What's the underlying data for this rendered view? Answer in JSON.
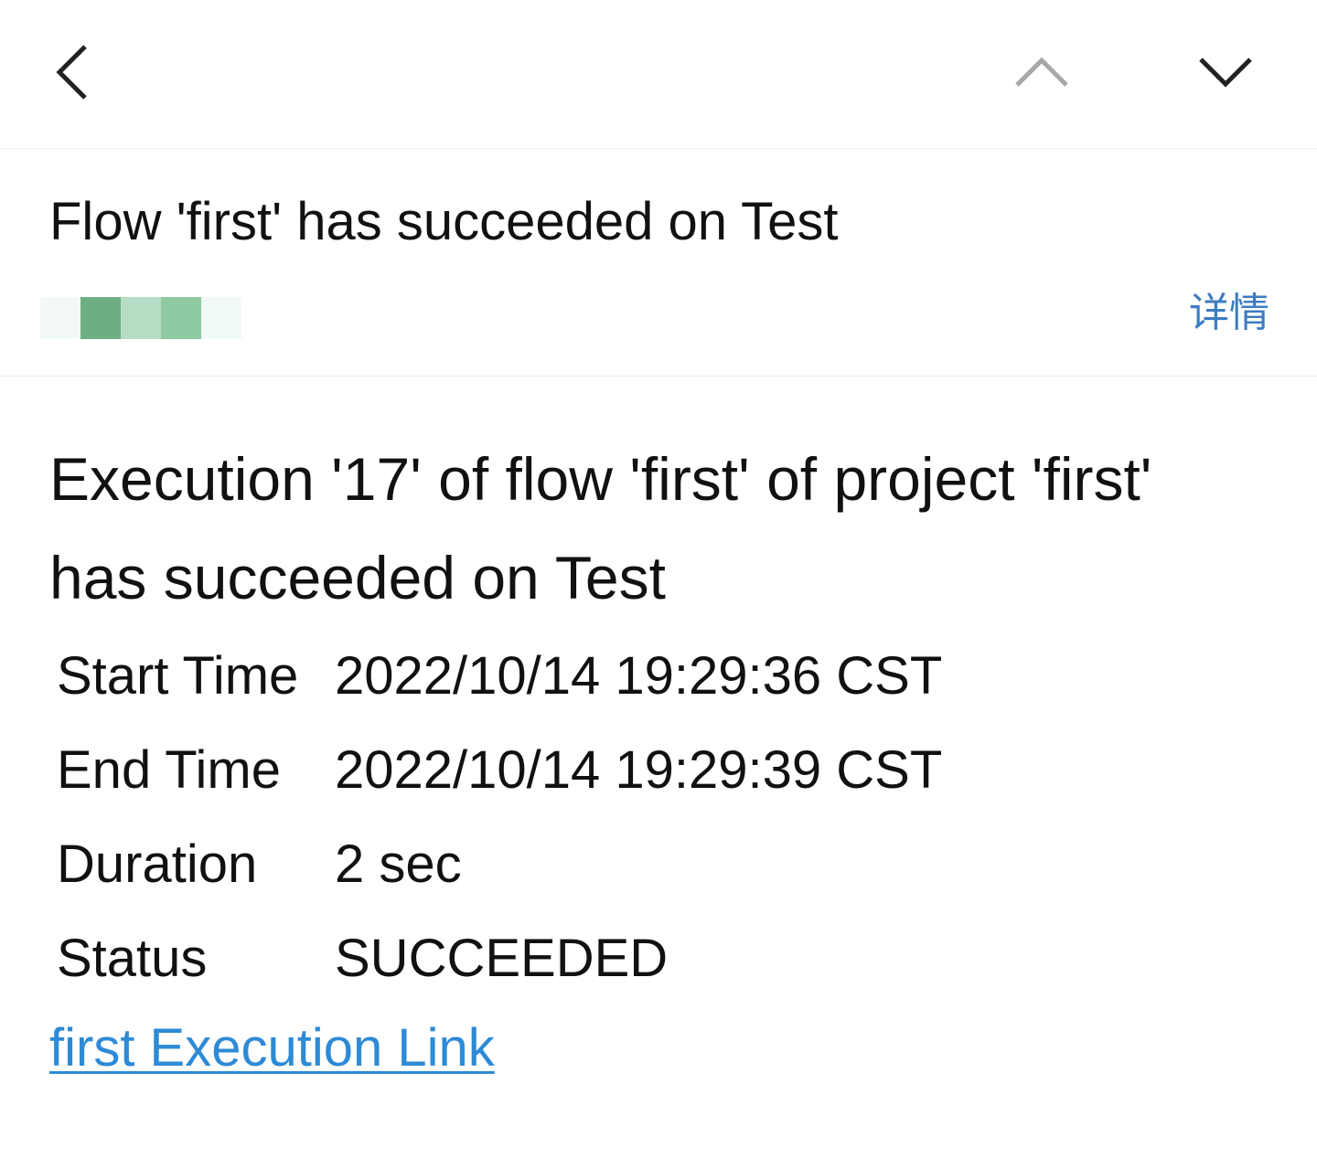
{
  "toolbar": {
    "back_icon": "chevron-left-icon",
    "prev_icon": "chevron-up-icon",
    "next_icon": "chevron-down-icon",
    "prev_color": "#a8a8a8",
    "next_color": "#222222"
  },
  "email": {
    "subject": "Flow 'first' has succeeded on Test",
    "details_label": "详情",
    "sender_blur_colors": [
      "#f3faf6",
      "#6daf82",
      "#b6dcc3",
      "#8fcaa3",
      "#f1faf4"
    ]
  },
  "body": {
    "heading": "Execution '17' of flow 'first' of project 'first' has succeeded on Test",
    "rows": [
      {
        "label": "Start Time",
        "value": "2022/10/14 19:29:36 CST"
      },
      {
        "label": "End Time",
        "value": "2022/10/14 19:29:39 CST"
      },
      {
        "label": "Duration",
        "value": "2 sec"
      },
      {
        "label": "Status",
        "value": "SUCCEEDED"
      }
    ],
    "link_text": "first Execution Link",
    "link_color": "#2d8ad6"
  }
}
